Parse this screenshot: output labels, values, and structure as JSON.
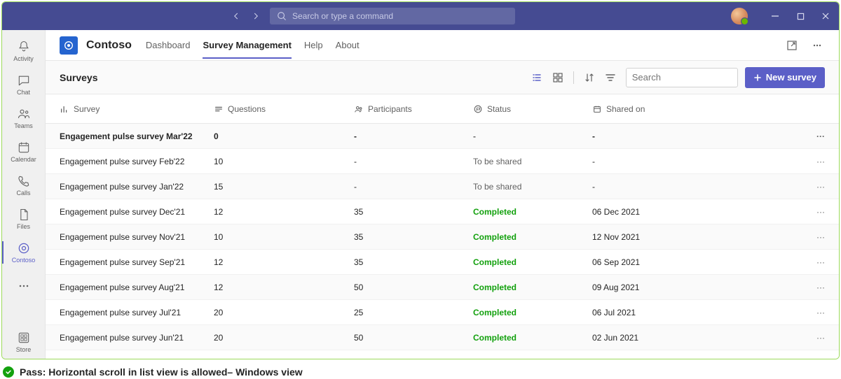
{
  "titlebar": {
    "search_placeholder": "Search or type a command"
  },
  "rail": {
    "items": [
      {
        "label": "Activity"
      },
      {
        "label": "Chat"
      },
      {
        "label": "Teams"
      },
      {
        "label": "Calendar"
      },
      {
        "label": "Calls"
      },
      {
        "label": "Files"
      },
      {
        "label": "Contoso"
      }
    ],
    "store_label": "Store"
  },
  "app": {
    "name": "Contoso",
    "tabs": [
      "Dashboard",
      "Survey Management",
      "Help",
      "About"
    ],
    "active_tab_index": 1
  },
  "toolbar": {
    "title": "Surveys",
    "search_placeholder": "Search",
    "new_label": "New survey"
  },
  "columns": {
    "survey": "Survey",
    "questions": "Questions",
    "participants": "Participants",
    "status": "Status",
    "shared_on": "Shared on"
  },
  "rows": [
    {
      "survey": "Engagement pulse survey Mar'22",
      "questions": "0",
      "participants": "-",
      "status": "-",
      "shared_on": "-"
    },
    {
      "survey": "Engagement pulse survey Feb'22",
      "questions": "10",
      "participants": "-",
      "status": "To be shared",
      "shared_on": "-"
    },
    {
      "survey": "Engagement pulse survey Jan'22",
      "questions": "15",
      "participants": "-",
      "status": "To be shared",
      "shared_on": "-"
    },
    {
      "survey": "Engagement pulse survey Dec'21",
      "questions": "12",
      "participants": "35",
      "status": "Completed",
      "shared_on": "06 Dec 2021"
    },
    {
      "survey": "Engagement pulse survey Nov'21",
      "questions": "10",
      "participants": "35",
      "status": "Completed",
      "shared_on": "12 Nov 2021"
    },
    {
      "survey": "Engagement pulse survey Sep'21",
      "questions": "12",
      "participants": "35",
      "status": "Completed",
      "shared_on": "06 Sep 2021"
    },
    {
      "survey": "Engagement pulse survey Aug'21",
      "questions": "12",
      "participants": "50",
      "status": "Completed",
      "shared_on": "09 Aug 2021"
    },
    {
      "survey": "Engagement pulse survey Jul'21",
      "questions": "20",
      "participants": "25",
      "status": "Completed",
      "shared_on": "06 Jul 2021"
    },
    {
      "survey": "Engagement pulse survey Jun'21",
      "questions": "20",
      "participants": "50",
      "status": "Completed",
      "shared_on": "02 Jun 2021"
    }
  ],
  "caption": "Pass: Horizontal scroll in list view is allowed– Windows view"
}
